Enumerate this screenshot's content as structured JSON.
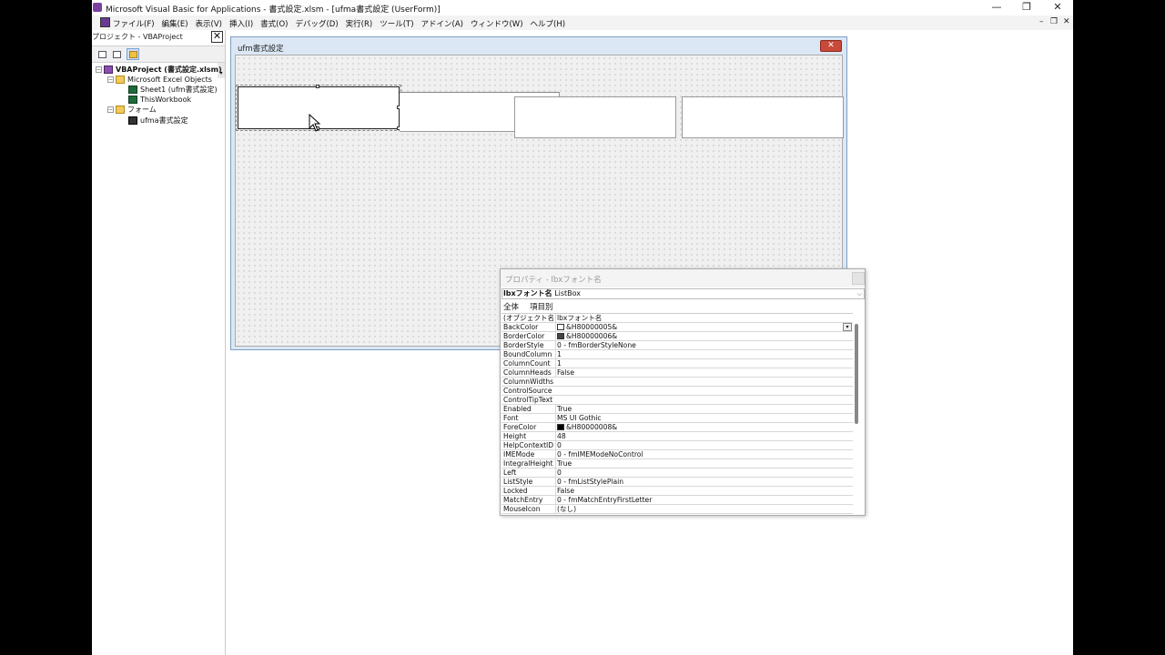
{
  "window": {
    "title": "Microsoft Visual Basic for Applications - 書式設定.xlsm - [ufma書式設定 (UserForm)]",
    "minimize": "—",
    "restore": "❐",
    "close": "✕"
  },
  "menu": {
    "items": [
      "ファイル(F)",
      "編集(E)",
      "表示(V)",
      "挿入(I)",
      "書式(O)",
      "デバッグ(D)",
      "実行(R)",
      "ツール(T)",
      "アドイン(A)",
      "ウィンドウ(W)",
      "ヘルプ(H)"
    ],
    "mdi_min": "–",
    "mdi_restore": "❐",
    "mdi_close": "✕"
  },
  "project": {
    "title": "プロジェクト - VBAProject",
    "close": "✕",
    "tree": {
      "root": "VBAProject (書式設定.xlsm)",
      "excel_objects": "Microsoft Excel Objects",
      "sheet1": "Sheet1 (ufm書式設定)",
      "workbook": "ThisWorkbook",
      "forms": "フォーム",
      "form1": "ufma書式設定"
    }
  },
  "userform": {
    "title": "ufm書式設定",
    "close": "✕"
  },
  "properties": {
    "title": "プロパティ - lbxフォント名",
    "object_name": "lbxフォント名",
    "object_type": "ListBox",
    "tab_all": "全体",
    "tab_category": "項目別",
    "rows": [
      {
        "name": "(オブジェクト名)",
        "value": "lbxフォント名"
      },
      {
        "name": "BackColor",
        "value": "&H80000005&",
        "swatch": "#ffffff",
        "dropdown": "▾"
      },
      {
        "name": "BorderColor",
        "value": "&H80000006&",
        "swatch": "#444444"
      },
      {
        "name": "BorderStyle",
        "value": "0 - fmBorderStyleNone"
      },
      {
        "name": "BoundColumn",
        "value": "1"
      },
      {
        "name": "ColumnCount",
        "value": "1"
      },
      {
        "name": "ColumnHeads",
        "value": "False"
      },
      {
        "name": "ColumnWidths",
        "value": ""
      },
      {
        "name": "ControlSource",
        "value": ""
      },
      {
        "name": "ControlTipText",
        "value": ""
      },
      {
        "name": "Enabled",
        "value": "True"
      },
      {
        "name": "Font",
        "value": "MS UI Gothic"
      },
      {
        "name": "ForeColor",
        "value": "&H80000008&",
        "swatch": "#000000"
      },
      {
        "name": "Height",
        "value": "48"
      },
      {
        "name": "HelpContextID",
        "value": "0"
      },
      {
        "name": "IMEMode",
        "value": "0 - fmIMEModeNoControl"
      },
      {
        "name": "IntegralHeight",
        "value": "True"
      },
      {
        "name": "Left",
        "value": "0"
      },
      {
        "name": "ListStyle",
        "value": "0 - fmListStylePlain"
      },
      {
        "name": "Locked",
        "value": "False"
      },
      {
        "name": "MatchEntry",
        "value": "0 - fmMatchEntryFirstLetter"
      },
      {
        "name": "MouseIcon",
        "value": "(なし)"
      }
    ]
  }
}
